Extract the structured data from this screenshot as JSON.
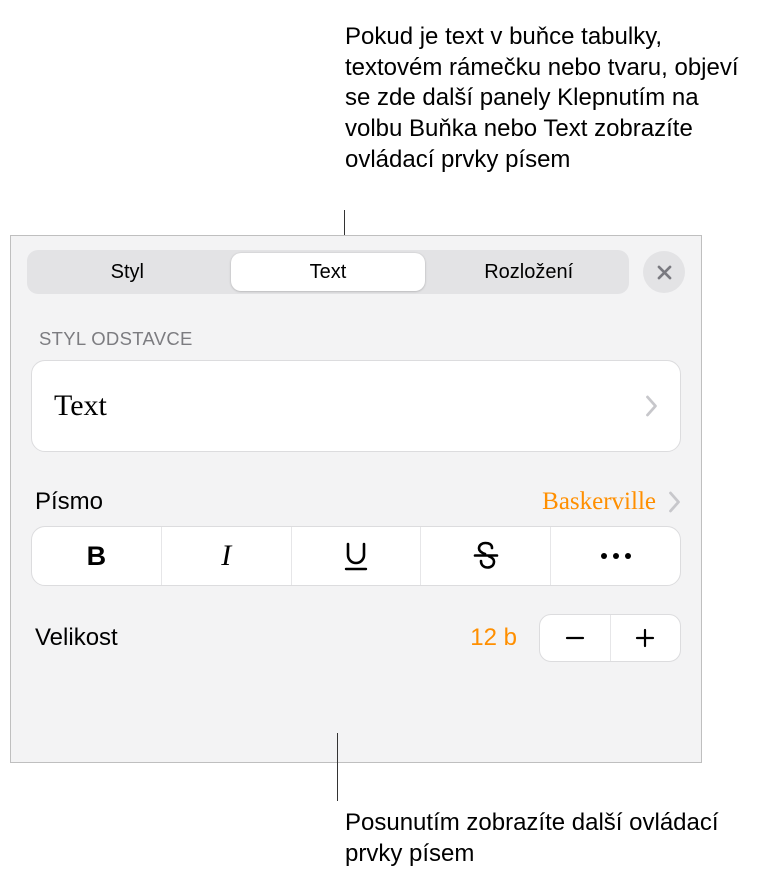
{
  "callouts": {
    "top": "Pokud je text v buňce tabulky, textovém rámečku nebo tvaru, objeví se zde další panely Klepnutím na volbu Buňka nebo Text zobrazíte ovládací prvky písem",
    "bottom": "Posunutím zobrazíte další ovládací prvky písem"
  },
  "tabs": [
    "Styl",
    "Text",
    "Rozložení"
  ],
  "activeTab": "Text",
  "sectionTitle": "STYL ODSTAVCE",
  "paragraphStyle": "Text",
  "font": {
    "label": "Písmo",
    "value": "Baskerville"
  },
  "size": {
    "label": "Velikost",
    "value": "12 b"
  },
  "colors": {
    "accent": "#ff8f00",
    "panelBg": "#f3f3f4",
    "segmentBg": "#e3e3e5"
  },
  "styleButtons": [
    "bold",
    "italic",
    "underline",
    "strikethrough",
    "more"
  ]
}
